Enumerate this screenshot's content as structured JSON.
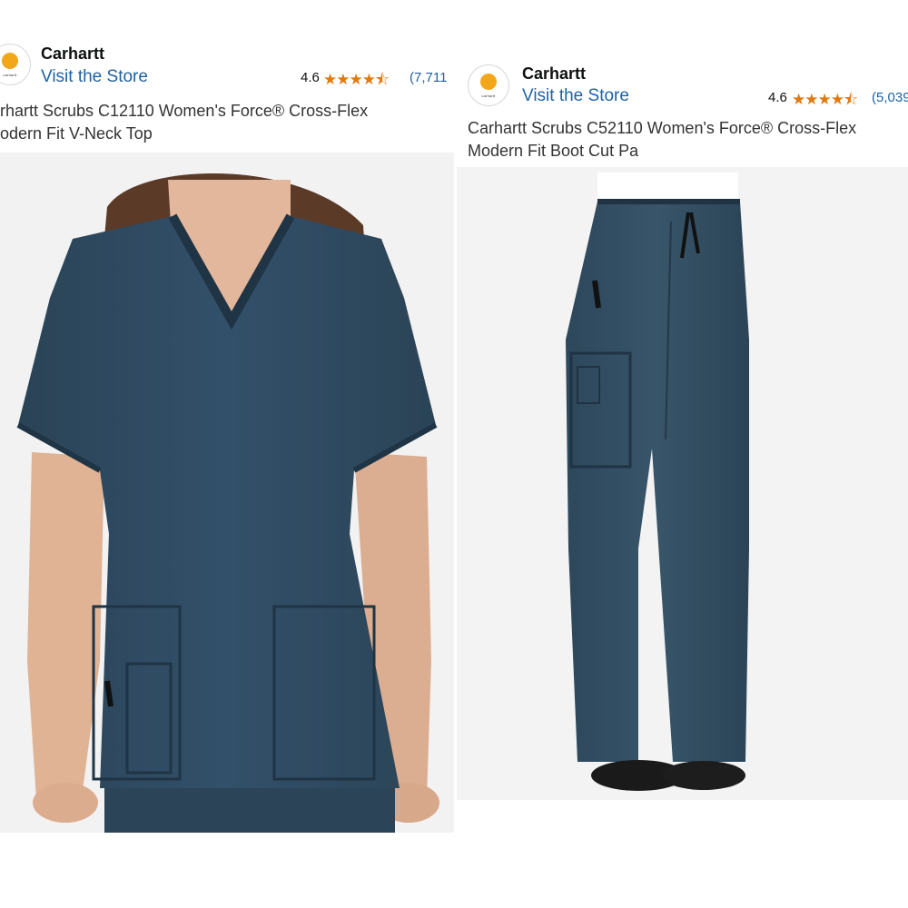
{
  "left_product": {
    "brand_logo_text": "carhartt",
    "brand": "Carhartt",
    "store_link": "Visit the Store",
    "rating": "4.6",
    "stars": "★★★★⯪",
    "review_count": "(7,711",
    "title_line1": "rhartt Scrubs C12110 Women's Force® Cross-Flex",
    "title_line2": "odern Fit V-Neck Top",
    "image_alt": "Woman wearing teal heather V-neck scrub top with pockets"
  },
  "right_product": {
    "brand_logo_text": "carhartt",
    "brand": "Carhartt",
    "store_link": "Visit the Store",
    "rating": "4.6",
    "stars": "★★★★⯪",
    "review_count": "(5,039",
    "title_line1": "Carhartt Scrubs C52110 Women's Force® Cross-Flex",
    "title_line2": "Modern Fit Boot Cut Pa",
    "image_alt": "Teal heather boot cut scrub pants with cargo pocket and drawstring"
  },
  "colors": {
    "link_blue": "#2162a1",
    "star_orange": "#e07a10",
    "scrub_teal": "#2f4a5e",
    "logo_orange": "#f2a71b"
  }
}
